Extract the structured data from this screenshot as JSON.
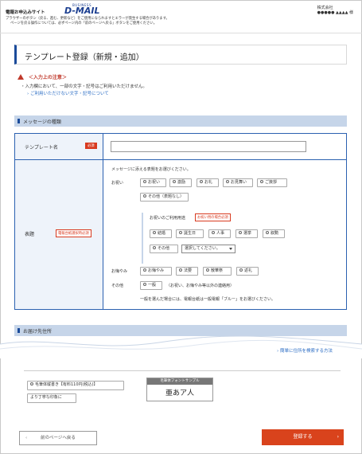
{
  "header": {
    "site_label": "電報お申込みサイト",
    "logo_business": "BUSINESS",
    "logo_main": "D-MAIL",
    "notice_line1": "ブラウザーのボタン（戻る、進む、更新など）をご使用になられますとエラーが発生する場合があります。",
    "notice_line2": "ページを戻る操作については、必ずページ内の「前のページへ戻る」ボタンをご使用ください。",
    "company": "株式会社",
    "user_name": "●●●●● ▲▲▲▲ 様"
  },
  "page_title": "テンプレート登録（新規・追加）",
  "caution": {
    "title": "＜入力上の注意＞",
    "body": "入力欄において、一部の文字・記号はご利用いただけません。",
    "link": "ご利用いただけない文字・記号について"
  },
  "message_section": {
    "heading": "メッセージの種類",
    "template_name_label": "テンプレート名",
    "required_badge": "必須",
    "template_name_value": "",
    "hyodai_label": "表題",
    "conditional_badge": "電報台紙選択時必須",
    "instruction": "メッセージに添える表題をお選びください。",
    "oiwai_label": "お祝い",
    "oiwai_options": [
      "お祝い",
      "激励",
      "お礼",
      "お見舞い",
      "ご挨拶"
    ],
    "other_label": "その他（表題なし）",
    "usage_label": "お祝いのご利用用途",
    "usage_badge": "お祝い用の場合必須",
    "usage_options": [
      "結婚",
      "誕生日",
      "人事",
      "選挙",
      "叙勲"
    ],
    "usage_other": "その他",
    "usage_select": "選択してください。",
    "okuyami_label": "お悔やみ",
    "okuyami_options": [
      "お悔やみ",
      "法要",
      "散華祭",
      "返礼"
    ],
    "sonota_label": "その他",
    "ippan_option": "一般",
    "ippan_note": "（お祝い、お悔やみ等以外の連絡用）",
    "footer_note": "一般を選んだ場合には、電報台紙は一般電報「ブルー」をお選びください。"
  },
  "delivery_section": {
    "heading": "お届け先住所",
    "address_link": "簡単に住所を検索する方法",
    "option_label": "毛筆体縦書き【有料110円(税込)】",
    "option_sub": "より丁寧な印象に",
    "font_sample_caption": "毛筆体フォントサンプル",
    "font_sample_text": "亜あア人"
  },
  "buttons": {
    "back": "前のページへ戻る",
    "submit": "登録する"
  }
}
